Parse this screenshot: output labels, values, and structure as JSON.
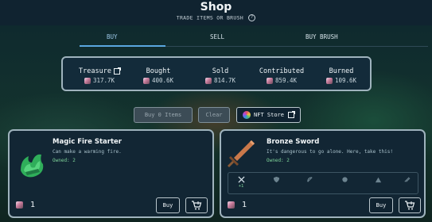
{
  "header": {
    "title": "Shop",
    "subtitle": "TRADE ITEMS OR BRUSH"
  },
  "tabs": [
    {
      "label": "BUY",
      "active": true
    },
    {
      "label": "SELL",
      "active": false
    },
    {
      "label": "BUY BRUSH",
      "active": false
    }
  ],
  "stats": {
    "treasure": {
      "label": "Treasure",
      "value": "317.7K"
    },
    "bought": {
      "label": "Bought",
      "value": "400.6K"
    },
    "sold": {
      "label": "Sold",
      "value": "814.7K"
    },
    "contributed": {
      "label": "Contributed",
      "value": "859.4K"
    },
    "burned": {
      "label": "Burned",
      "value": "109.6K"
    }
  },
  "actions": {
    "buy_items_label": "Buy 0 Items",
    "clear_label": "Clear",
    "nft_store_label": "NFT Store"
  },
  "items": [
    {
      "name": "Magic Fire Starter",
      "description": "Can make a warming fire.",
      "owned": "Owned: 2",
      "price": "1",
      "buy_label": "Buy",
      "icon": "fire-starter-icon"
    },
    {
      "name": "Bronze Sword",
      "description": "It's dangerous to go alone. Here, take this!",
      "owned": "Owned: 2",
      "price": "1",
      "buy_label": "Buy",
      "icon": "bronze-sword-icon",
      "stat_bonus": "+1"
    }
  ],
  "colors": {
    "accent": "#5aa7e0",
    "owned": "#7fd49a",
    "panel": "#132b3a"
  }
}
